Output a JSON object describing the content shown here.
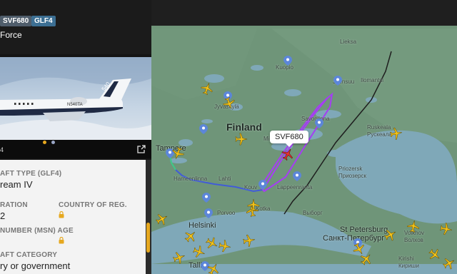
{
  "flight": {
    "callsign": "SVF680",
    "aircraft_code": "GLF4",
    "operator_partial": "Force"
  },
  "photo": {
    "tail_partial": "N540TA",
    "tail_fin_text": "540",
    "reg_partial": "4",
    "dots_total": 2,
    "dots_active": 1
  },
  "details": {
    "aircraft_type_label": "AFT TYPE (GLF4)",
    "aircraft_type_value": "ream IV",
    "registration_label": "RATION",
    "registration_value": "2",
    "country_label": "COUNTRY OF REG.",
    "serial_label": "NUMBER (MSN) AGE",
    "category_label": "AFT CATEGORY",
    "category_value": "ry or government"
  },
  "map": {
    "country_label": "Finland",
    "tooltip": "SVF680",
    "cities": {
      "lieksa": "Lieksa",
      "kuopio": "Kuopio",
      "joensuu": "Joensuu",
      "ilomantsi": "Ilomantsi",
      "jyvaskyla": "Jyväskylä",
      "tampere": "Tampere",
      "savonlinna": "Savonlinna",
      "ruskeala": "Ruskeala",
      "ruskeala_ru": "Рускеала",
      "mi": "Mi",
      "lahti": "Lahti",
      "hameenlinna": "Hameenlinna",
      "kouvola": "Kouv",
      "lappeenranta": "Lappeenranta",
      "priozersk": "Priozersk",
      "priozersk_ru": "Приозерск",
      "porvoo": "Porvoo",
      "kotka": "Kotka",
      "vyborg": "Выборг",
      "helsinki": "Helsinki",
      "st_petersburg": "St Petersburg",
      "st_petersburg_ru": "Санкт-Петербург",
      "volkhov": "Volkhov",
      "volkhov_ru": "Волхов",
      "kirishi": "Kirishi",
      "kirishi_ru": "Кириши",
      "tallinn": "Tallin"
    }
  },
  "colors": {
    "map_land": "#6e9478",
    "water": "#7fa8b8",
    "route_purple": "#a63cf5",
    "route_blue": "#4459d6",
    "route_green": "#3ec98a",
    "plane_yellow": "#f2c21b",
    "selected_plane": "#e5302f",
    "badge_callsign": "#4f5d6b",
    "badge_type": "#3c6f93",
    "accent_lock": "#e6a81f"
  },
  "icons": {
    "pin": "location-pin-icon",
    "plane": "airplane-icon",
    "lock": "lock-icon",
    "expand": "expand-icon"
  }
}
